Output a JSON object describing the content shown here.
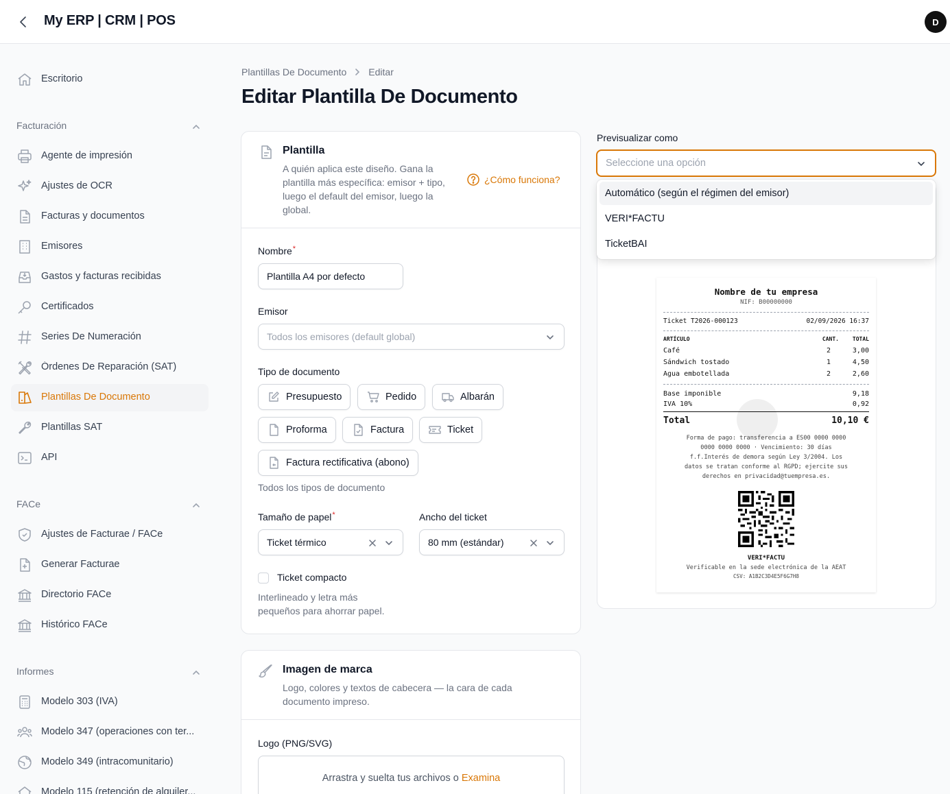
{
  "app": {
    "brand": "My ERP | CRM | POS",
    "avatar_initial": "D"
  },
  "sidebar": {
    "top_item": {
      "label": "Escritorio",
      "icon": "home-icon"
    },
    "groups": [
      {
        "label": "Facturación",
        "items": [
          {
            "label": "Agente de impresión",
            "icon": "printer-icon"
          },
          {
            "label": "Ajustes de OCR",
            "icon": "sparkles-icon"
          },
          {
            "label": "Facturas y documentos",
            "icon": "document-icon"
          },
          {
            "label": "Emisores",
            "icon": "building-icon"
          },
          {
            "label": "Gastos y facturas recibidas",
            "icon": "inbox-icon"
          },
          {
            "label": "Certificados",
            "icon": "key-icon"
          },
          {
            "label": "Series De Numeración",
            "icon": "hashtag-icon"
          },
          {
            "label": "Órdenes De Reparación (SAT)",
            "icon": "tools-icon"
          },
          {
            "label": "Plantillas De Documento",
            "icon": "template-icon",
            "active": true
          },
          {
            "label": "Plantillas SAT",
            "icon": "wrench-icon"
          },
          {
            "label": "API",
            "icon": "terminal-icon"
          }
        ]
      },
      {
        "label": "FACe",
        "items": [
          {
            "label": "Ajustes de Facturae / FACe",
            "icon": "shield-check-icon"
          },
          {
            "label": "Generar Facturae",
            "icon": "document-plus-icon"
          },
          {
            "label": "Directorio FACe",
            "icon": "bank-icon"
          },
          {
            "label": "Histórico FACe",
            "icon": "bank-icon"
          }
        ]
      },
      {
        "label": "Informes",
        "items": [
          {
            "label": "Modelo 303 (IVA)",
            "icon": "calculator-icon"
          },
          {
            "label": "Modelo 347 (operaciones con ter...",
            "icon": "users-icon"
          },
          {
            "label": "Modelo 349 (intracomunitario)",
            "icon": "globe-icon"
          },
          {
            "label": "Modelo 115 (retención de alquiler...",
            "icon": "home-icon"
          }
        ]
      }
    ]
  },
  "breadcrumb": {
    "parent": "Plantillas De Documento",
    "current": "Editar"
  },
  "page_title": "Editar Plantilla De Documento",
  "template_card": {
    "title": "Plantilla",
    "description": "A quién aplica este diseño. Gana la plantilla más específica: emisor + tipo, luego el default del emisor, luego la global.",
    "help_link": "¿Cómo funciona?",
    "name_label": "Nombre",
    "name_value": "Plantilla A4 por defecto",
    "issuer_label": "Emisor",
    "issuer_placeholder": "Todos los emisores (default global)",
    "doctype_label": "Tipo de documento",
    "doctypes": [
      {
        "label": "Presupuesto",
        "icon": "pencil-square-icon"
      },
      {
        "label": "Pedido",
        "icon": "cart-icon"
      },
      {
        "label": "Albarán",
        "icon": "truck-icon"
      },
      {
        "label": "Proforma",
        "icon": "document-icon"
      },
      {
        "label": "Factura",
        "icon": "document-check-icon"
      },
      {
        "label": "Ticket",
        "icon": "ticket-icon"
      },
      {
        "label": "Factura rectificativa (abono)",
        "icon": "document-return-icon"
      }
    ],
    "doctype_hint": "Todos los tipos de documento",
    "paper_label": "Tamaño de papel",
    "paper_value": "Ticket térmico",
    "ticket_width_label": "Ancho del ticket",
    "ticket_width_value": "80 mm (estándar)",
    "compact_label": "Ticket compacto",
    "compact_checked": false,
    "compact_hint": "Interlineado y letra más pequeños para ahorrar papel."
  },
  "brand_card": {
    "title": "Imagen de marca",
    "description": "Logo, colores y textos de cabecera — la cara de cada documento impreso.",
    "logo_label": "Logo (PNG/SVG)",
    "upload_text": "Arrastra y suelta tus archivos o",
    "upload_link": "Examina"
  },
  "preview": {
    "label": "Previsualizar como",
    "placeholder": "Seleccione una opción",
    "options": [
      "Automático (según el régimen del emisor)",
      "VERI*FACTU",
      "TicketBAI"
    ],
    "highlighted_option": 0
  },
  "receipt": {
    "company": "Nombre de tu empresa",
    "nif": "NIF: B00000000",
    "ticket_no": "Ticket T2026-000123",
    "datetime": "02/09/2026 16:37",
    "col_item": "ARTÍCULO",
    "col_qty": "CANT.",
    "col_total": "TOTAL",
    "lines": [
      {
        "item": "Café",
        "qty": "2",
        "total": "3,00"
      },
      {
        "item": "Sándwich tostado",
        "qty": "1",
        "total": "4,50"
      },
      {
        "item": "Agua embotellada",
        "qty": "2",
        "total": "2,60"
      }
    ],
    "base_label": "Base imponible",
    "base_value": "9,18",
    "iva_label": "IVA 10%",
    "iva_value": "0,92",
    "total_label": "Total",
    "total_value": "10,10 €",
    "footer_lines": [
      "Forma de pago: transferencia a ES00 0000 0000",
      "0000 0000 0000 · Vencimiento: 30 días",
      "f.f.Interés de demora según Ley 3/2004. Los",
      "datos se tratan conforme al RGPD; ejercite sus",
      "derechos en privacidad@tuempresa.es."
    ],
    "verifactu_title": "VERI*FACTU",
    "verifactu_text": "Verificable en la sede electrónica de la AEAT",
    "csv": "CSV: A1B2C3D4E5F6G7H8"
  }
}
